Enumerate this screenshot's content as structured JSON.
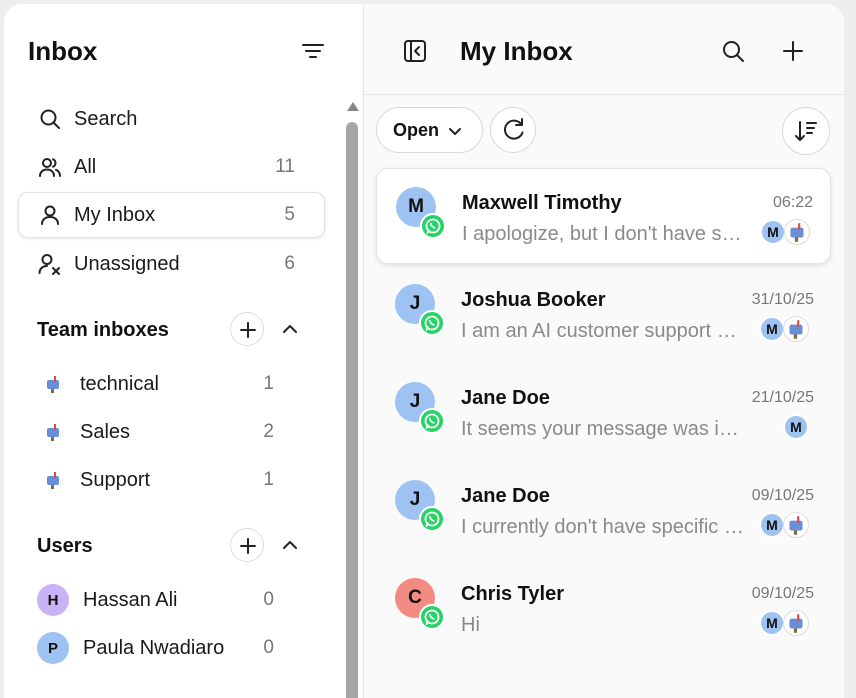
{
  "sidebar": {
    "title": "Inbox",
    "nav": [
      {
        "label": "Search",
        "count": ""
      },
      {
        "label": "All",
        "count": "11"
      },
      {
        "label": "My Inbox",
        "count": "5"
      },
      {
        "label": "Unassigned",
        "count": "6"
      }
    ],
    "team_section": {
      "title": "Team inboxes"
    },
    "teams": [
      {
        "label": "technical",
        "count": "1"
      },
      {
        "label": "Sales",
        "count": "2"
      },
      {
        "label": "Support",
        "count": "1"
      }
    ],
    "users_section": {
      "title": "Users"
    },
    "users": [
      {
        "initial": "H",
        "name": "Hassan Ali",
        "count": "0",
        "color": "#c7b3f5"
      },
      {
        "initial": "P",
        "name": "Paula Nwadiaro",
        "count": "0",
        "color": "#9ec2f2"
      }
    ]
  },
  "main": {
    "title": "My Inbox",
    "filter": {
      "label": "Open"
    },
    "conversations": [
      {
        "initial": "M",
        "name": "Maxwell Timothy",
        "time": "06:22",
        "preview": "I apologize, but I don't have specific information",
        "avatar_color": "#9ec2f2",
        "assignee": "M",
        "has_inbox": true
      },
      {
        "initial": "J",
        "name": "Joshua Booker",
        "time": "31/10/25",
        "preview": "I am an AI customer support assistant",
        "avatar_color": "#9ec2f2",
        "assignee": "M",
        "has_inbox": true
      },
      {
        "initial": "J",
        "name": "Jane Doe",
        "time": "21/10/25",
        "preview": "It seems your message was incomplete",
        "avatar_color": "#9ec2f2",
        "assignee": "M",
        "has_inbox": false
      },
      {
        "initial": "J",
        "name": "Jane Doe",
        "time": "09/10/25",
        "preview": "I currently don't have specific information",
        "avatar_color": "#9ec2f2",
        "assignee": "M",
        "has_inbox": true
      },
      {
        "initial": "C",
        "name": "Chris Tyler",
        "time": "09/10/25",
        "preview": "Hi",
        "avatar_color": "#f28b82",
        "assignee": "M",
        "has_inbox": true
      }
    ]
  },
  "icons": {
    "filter": "filter-lines-icon",
    "search": "search-icon",
    "all": "users-icon",
    "my_inbox": "user-icon",
    "unassigned": "user-x-icon",
    "team_inbox": "mailbox-icon",
    "collapse": "sidebar-collapse-icon",
    "add": "plus-icon",
    "chevron_up": "chevron-up-icon",
    "chevron_down": "chevron-down-icon",
    "refresh": "refresh-chat-icon",
    "sort": "sort-desc-icon",
    "channel": "whatsapp-icon"
  },
  "colors": {
    "whatsapp": "#25d366",
    "assignee_avatar": "#9ec2f2",
    "panel_bg": "#ffffff"
  }
}
